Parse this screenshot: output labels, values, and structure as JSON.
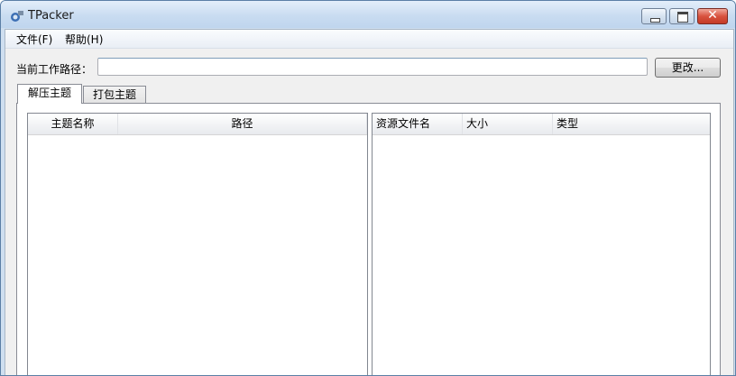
{
  "window": {
    "title": "TPacker",
    "icons": {
      "app": "app-icon",
      "minimize": "minimize-icon",
      "maximize": "maximize-icon",
      "close": "close-icon"
    },
    "close_glyph": "✕"
  },
  "menu": {
    "file": "文件(F)",
    "help": "帮助(H)"
  },
  "path": {
    "label": "当前工作路径：",
    "value": "",
    "change_button": "更改..."
  },
  "tabs": [
    {
      "label": "解压主题",
      "selected": true
    },
    {
      "label": "打包主题",
      "selected": false
    }
  ],
  "theme_list": {
    "columns": [
      "主题名称",
      "路径"
    ],
    "rows": []
  },
  "resource_list": {
    "columns": [
      "资源文件名",
      "大小",
      "类型"
    ],
    "rows": []
  }
}
